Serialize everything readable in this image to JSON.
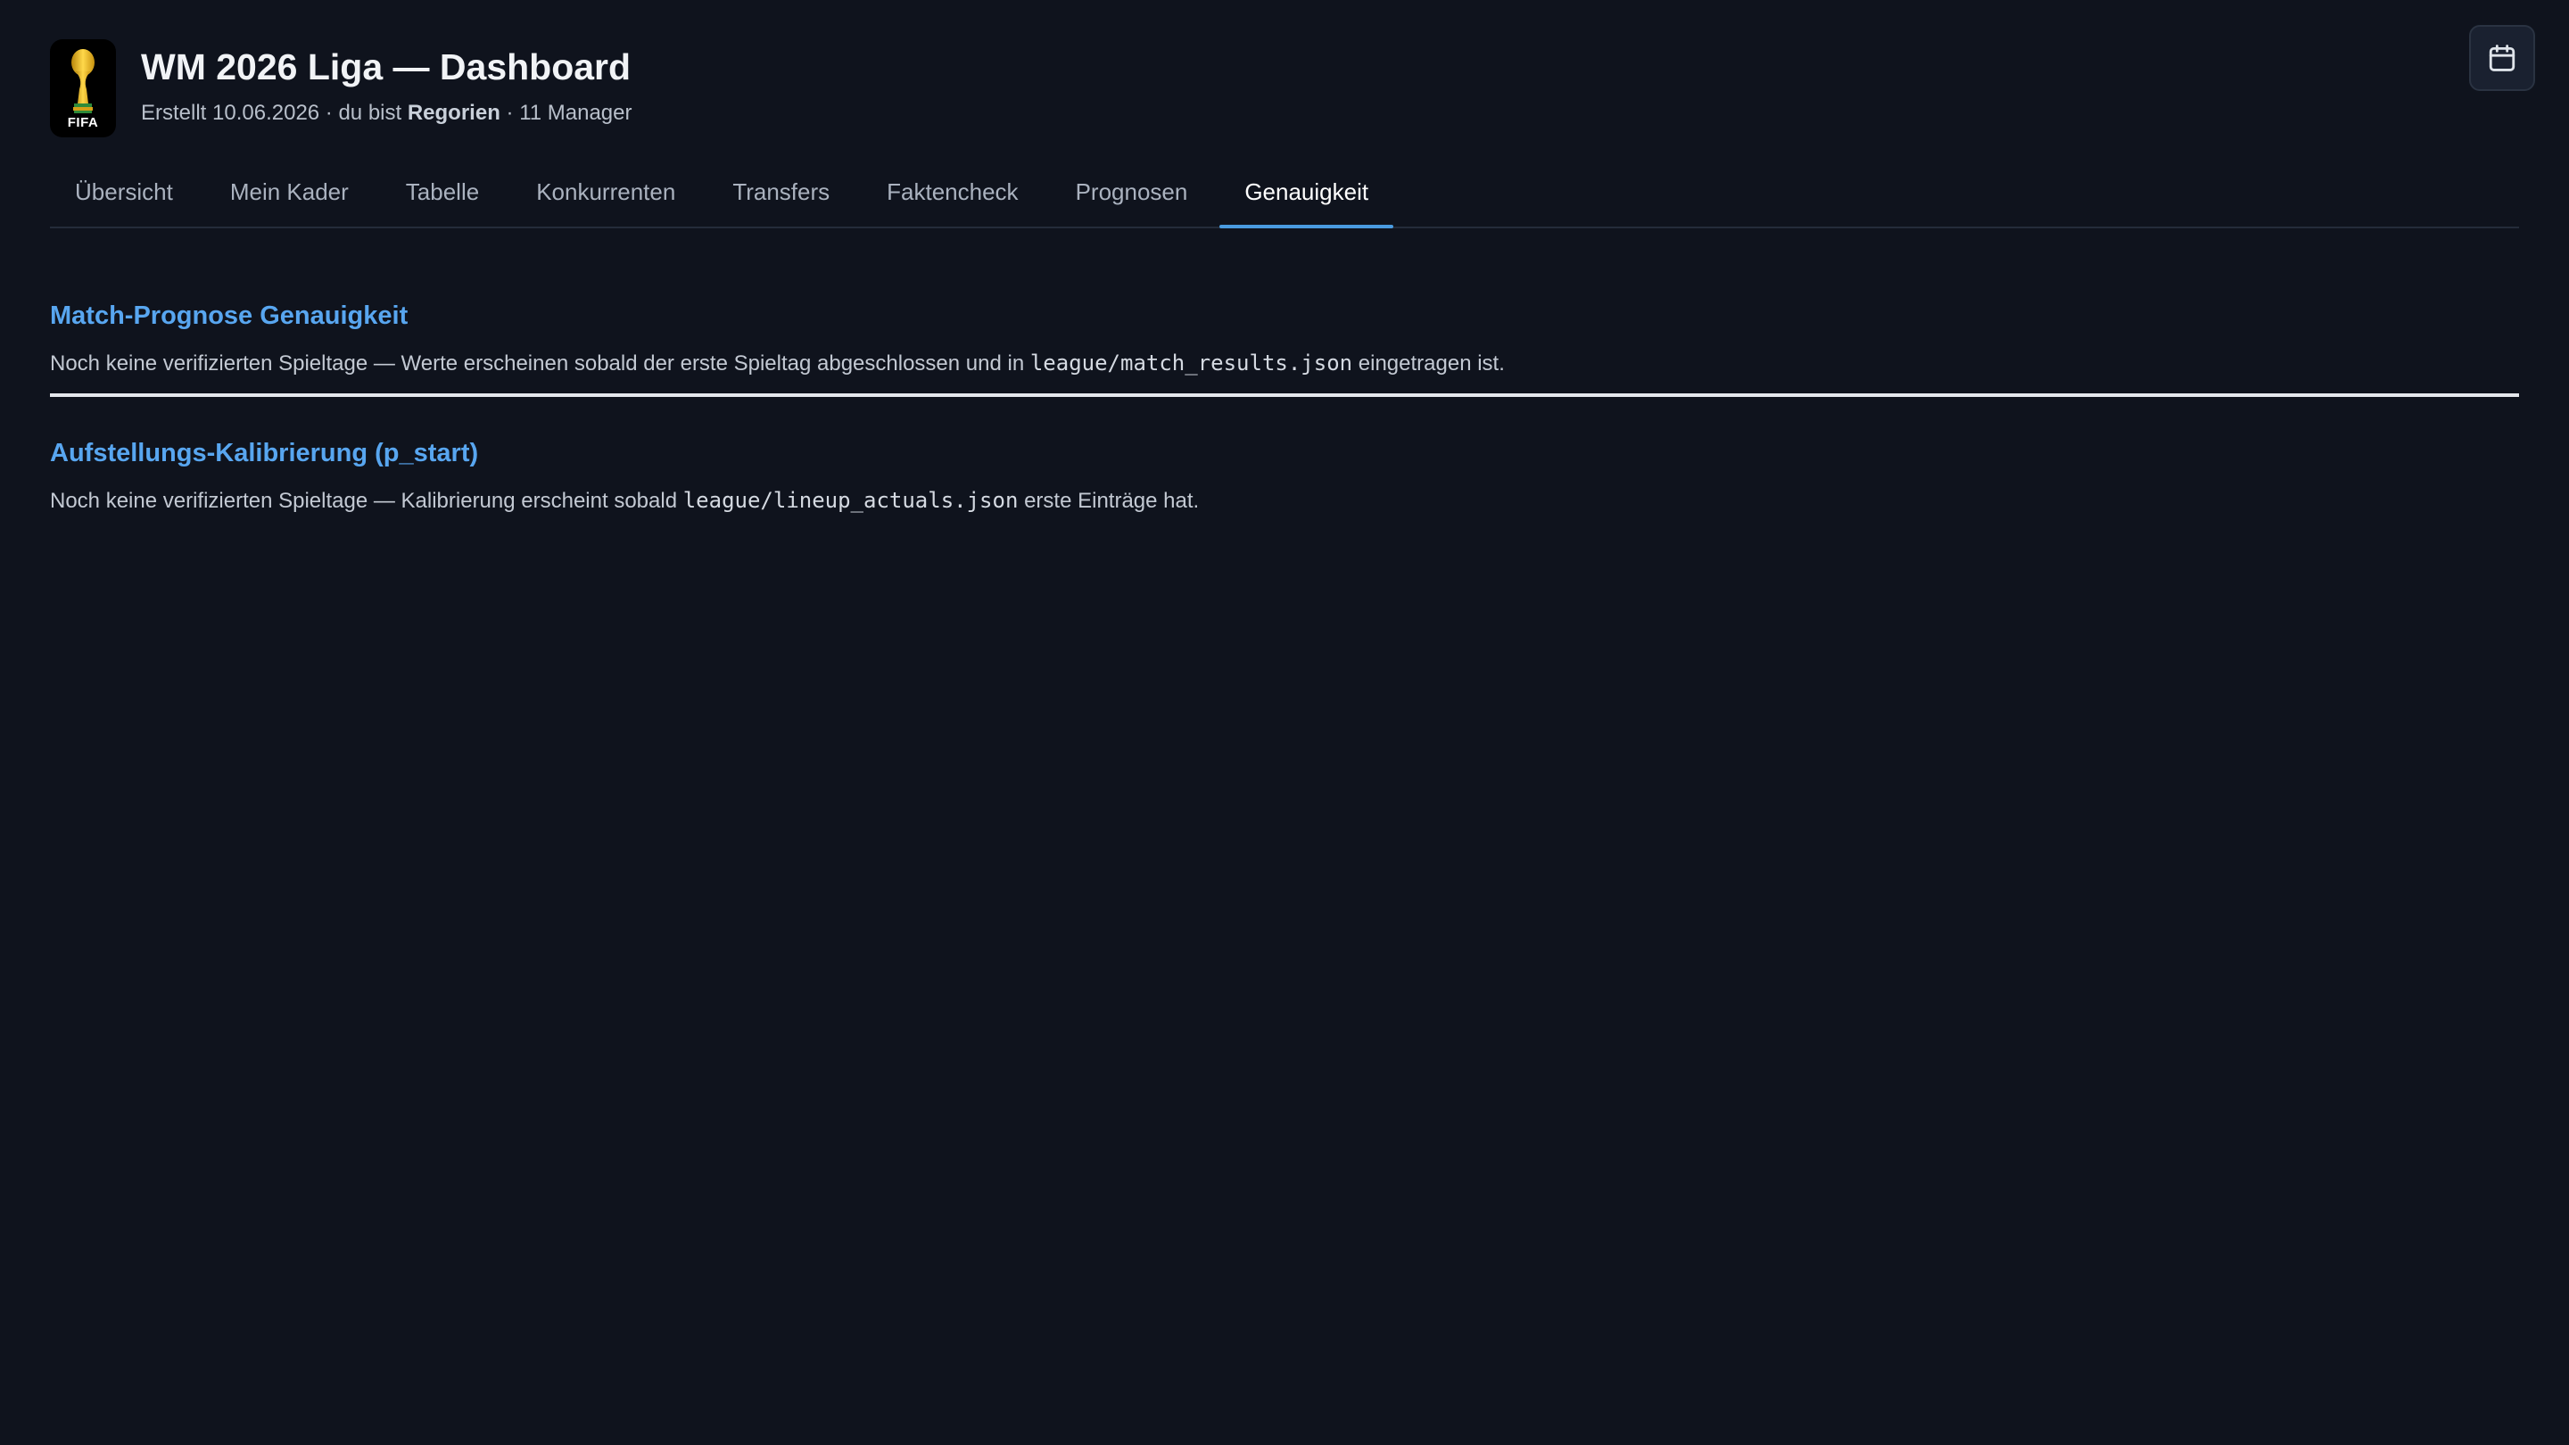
{
  "header": {
    "logo_text": "FIFA",
    "title": "WM 2026 Liga — Dashboard",
    "subtitle_prefix": "Erstellt 10.06.2026 · du bist ",
    "user": "Regorien",
    "subtitle_suffix": " · 11 Manager",
    "calendar_icon": "calendar-icon"
  },
  "tabs": [
    {
      "label": "Übersicht",
      "active": false
    },
    {
      "label": "Mein Kader",
      "active": false
    },
    {
      "label": "Tabelle",
      "active": false
    },
    {
      "label": "Konkurrenten",
      "active": false
    },
    {
      "label": "Transfers",
      "active": false
    },
    {
      "label": "Faktencheck",
      "active": false
    },
    {
      "label": "Prognosen",
      "active": false
    },
    {
      "label": "Genauigkeit",
      "active": true
    }
  ],
  "sections": {
    "match": {
      "title": "Match-Prognose Genauigkeit",
      "text_before": "Noch keine verifizierten Spieltage — Werte erscheinen sobald der erste Spieltag abgeschlossen und in ",
      "code": "league/match_results.json",
      "text_after": " eingetragen ist."
    },
    "lineup": {
      "title": "Aufstellungs-Kalibrierung (p_start)",
      "text_before": "Noch keine verifizierten Spieltage — Kalibrierung erscheint sobald ",
      "code": "league/lineup_actuals.json",
      "text_after": " erste Einträge hat."
    }
  },
  "colors": {
    "background": "#0f131d",
    "accent": "#58a6f0",
    "tab_underline": "#4a9be0"
  }
}
